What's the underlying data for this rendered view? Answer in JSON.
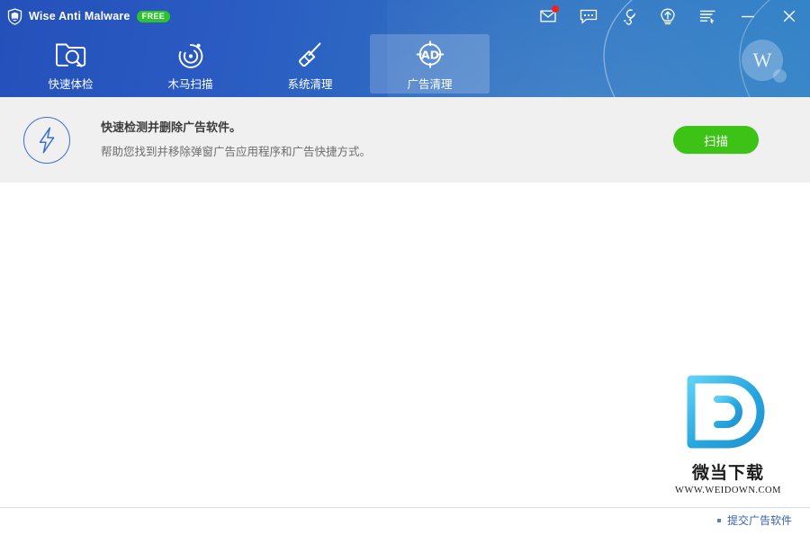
{
  "window": {
    "app_name": "Wise Anti Malware",
    "edition_badge": "FREE",
    "logo_icon": "shield-icon"
  },
  "titlebar": {
    "buttons": [
      {
        "name": "feedback-mail-button",
        "icon": "envelope-icon",
        "has_badge": true
      },
      {
        "name": "chat-button",
        "icon": "chat-bubble-icon",
        "has_badge": false
      },
      {
        "name": "tools-button",
        "icon": "wrench-icon",
        "has_badge": false
      },
      {
        "name": "upgrade-button",
        "icon": "upgrade-arrow-icon",
        "has_badge": false
      },
      {
        "name": "menu-button",
        "icon": "menu-list-icon",
        "has_badge": false
      },
      {
        "name": "minimize-button",
        "icon": "minimize-icon",
        "has_badge": false
      },
      {
        "name": "close-button",
        "icon": "close-icon",
        "has_badge": false
      }
    ]
  },
  "nav": {
    "tabs": [
      {
        "label": "快速体检",
        "icon": "folder-search-icon",
        "active": false
      },
      {
        "label": "木马扫描",
        "icon": "radar-scan-icon",
        "active": false
      },
      {
        "label": "系统清理",
        "icon": "broom-icon",
        "active": false
      },
      {
        "label": "广告清理",
        "icon": "ad-target-icon",
        "active": true
      }
    ],
    "avatar_letter": "W"
  },
  "banner": {
    "icon": "lightning-bolt-icon",
    "title": "快速检测并删除广告软件。",
    "subtitle": "帮助您找到并移除弹窗广告应用程序和广告快捷方式。",
    "scan_button_label": "扫描"
  },
  "footer": {
    "submit_link_label": "提交广告软件"
  },
  "watermark": {
    "logo_letter": "D",
    "site_name_cn": "微当下载",
    "site_url": "WWW.WEIDOWN.COM"
  },
  "colors": {
    "header_left": "#2450ba",
    "header_right": "#3484c8",
    "accent_green": "#3dc216",
    "badge_green": "#2fc22f",
    "notification_red": "#f42020",
    "banner_bg": "#f0f0f0",
    "link_blue": "#3a62b8",
    "watermark_blue": "#29a8e0"
  }
}
